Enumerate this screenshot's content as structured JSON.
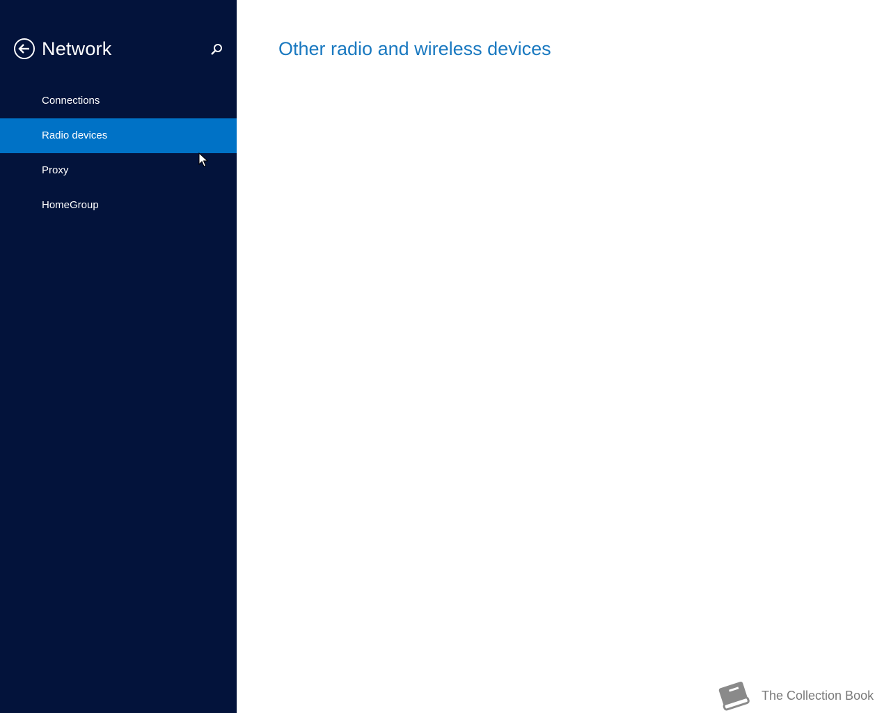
{
  "sidebar": {
    "title": "Network",
    "back_icon": "back-arrow-circle-icon",
    "search_icon": "search-icon",
    "items": [
      {
        "label": "Connections",
        "selected": false
      },
      {
        "label": "Radio devices",
        "selected": true
      },
      {
        "label": "Proxy",
        "selected": false
      },
      {
        "label": "HomeGroup",
        "selected": false
      }
    ]
  },
  "main": {
    "heading": "Other radio and wireless devices"
  },
  "watermark": {
    "text": "The Collection Book",
    "icon": "book-icon"
  },
  "colors": {
    "sidebar_background": "#03133b",
    "selected_item": "#0072c6",
    "heading": "#1a79c0",
    "main_background": "#ffffff"
  }
}
